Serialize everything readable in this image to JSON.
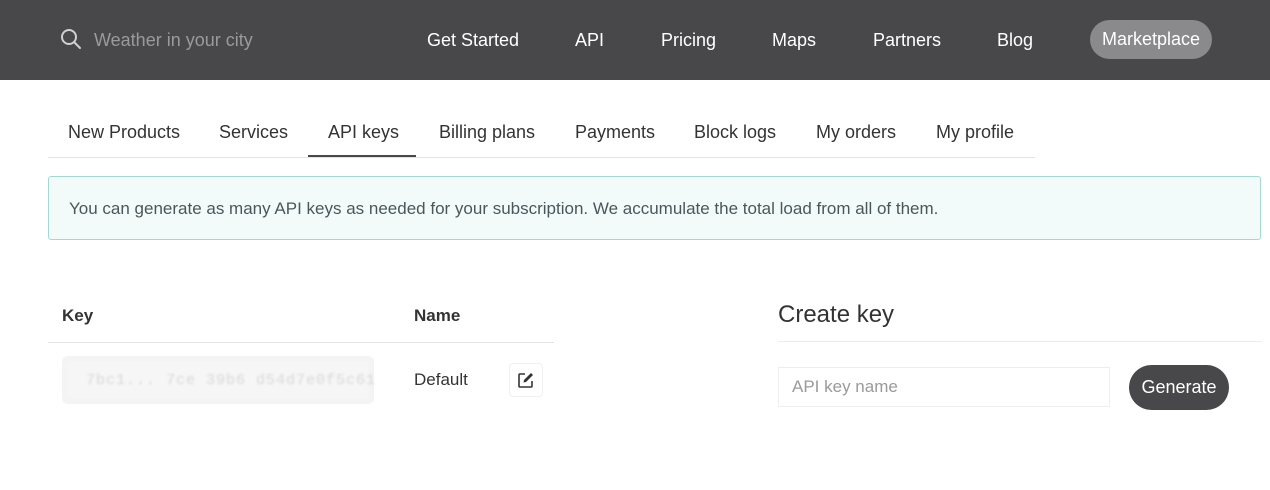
{
  "header": {
    "search_placeholder": "Weather in your city",
    "nav": [
      "Get Started",
      "API",
      "Pricing",
      "Maps",
      "Partners",
      "Blog"
    ],
    "marketplace": "Marketplace"
  },
  "tabs": {
    "items": [
      "New Products",
      "Services",
      "API keys",
      "Billing plans",
      "Payments",
      "Block logs",
      "My orders",
      "My profile"
    ],
    "active": "API keys"
  },
  "alert": {
    "text": "You can generate as many API keys as needed for your subscription. We accumulate the total load from all of them."
  },
  "keys_table": {
    "headers": {
      "key": "Key",
      "name": "Name"
    },
    "rows": [
      {
        "key": "7bc1... 7ce 39b6 d54d7e0f5c61",
        "name": "Default"
      }
    ]
  },
  "create_key": {
    "title": "Create key",
    "input_placeholder": "API key name",
    "button": "Generate"
  },
  "colors": {
    "topbar": "#48484a",
    "marketplace_pill": "#8a8a8c",
    "alert_bg": "#f3fbfa",
    "alert_border": "#a6d8d2",
    "button": "#48484a"
  }
}
